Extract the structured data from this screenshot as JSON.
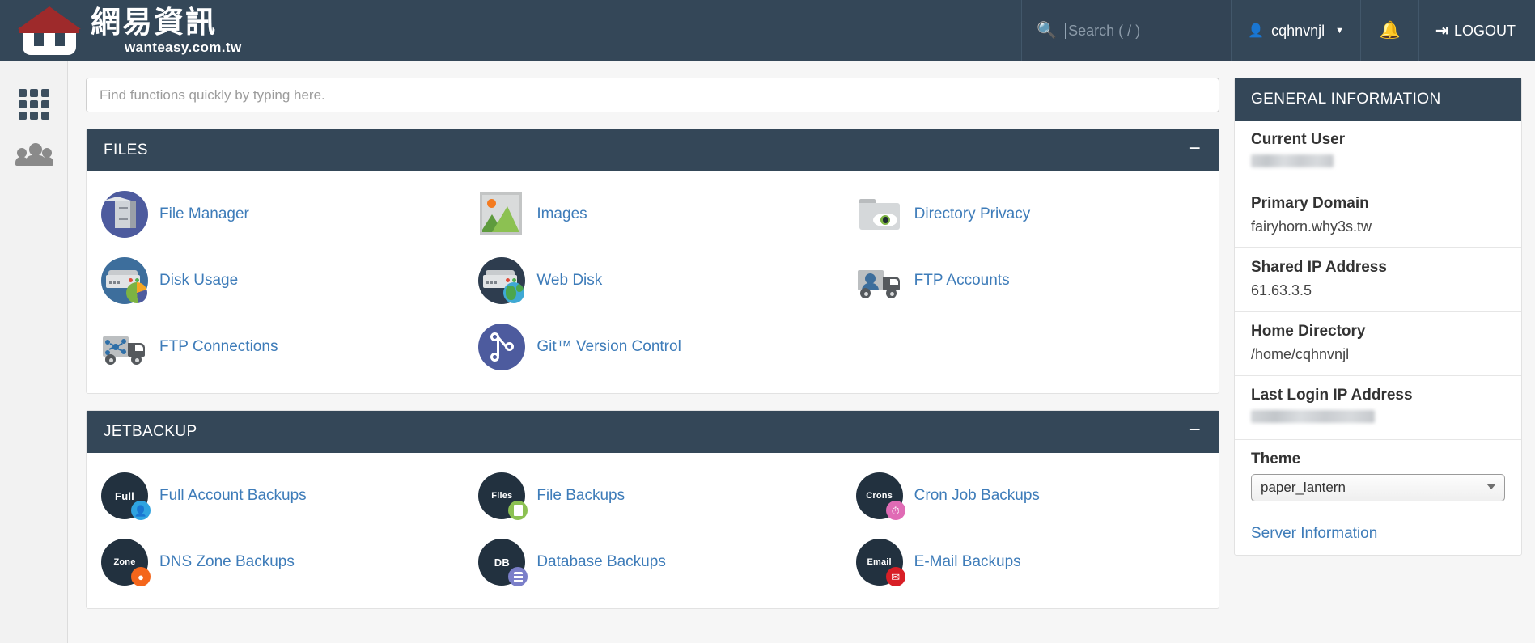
{
  "header": {
    "brand_cn": "網易資訊",
    "brand_en": "wanteasy.com.tw",
    "search_placeholder": "Search ( / )",
    "search_value": "",
    "user_name": "cqhnvnjl",
    "logout_label": "LOGOUT",
    "icons": {
      "search": "search-icon",
      "user": "user-icon",
      "chevron": "chevron-down-icon",
      "bell": "bell-icon",
      "logout": "logout-icon"
    },
    "bg_color": "#344758"
  },
  "sidebar": {
    "items": [
      {
        "name": "sidebar-item-tools",
        "icon": "grid-icon",
        "active": true
      },
      {
        "name": "sidebar-item-user-manager",
        "icon": "users-icon",
        "active": false
      }
    ]
  },
  "main": {
    "find_placeholder": "Find functions quickly by typing here.",
    "find_value": "",
    "sections": [
      {
        "title": "FILES",
        "collapse_label": "−",
        "items": [
          {
            "label": "File Manager",
            "icon": "file-manager-icon"
          },
          {
            "label": "Images",
            "icon": "images-icon"
          },
          {
            "label": "Directory Privacy",
            "icon": "directory-privacy-icon"
          },
          {
            "label": "Disk Usage",
            "icon": "disk-usage-icon"
          },
          {
            "label": "Web Disk",
            "icon": "web-disk-icon"
          },
          {
            "label": "FTP Accounts",
            "icon": "ftp-accounts-icon"
          },
          {
            "label": "FTP Connections",
            "icon": "ftp-connections-icon"
          },
          {
            "label": "Git™ Version Control",
            "icon": "git-version-control-icon"
          }
        ]
      },
      {
        "title": "JETBACKUP",
        "collapse_label": "−",
        "items": [
          {
            "label": "Full Account Backups",
            "icon": "jetbackup-full-icon",
            "badge_text": "Full",
            "badge_color": "#2fa3e0"
          },
          {
            "label": "File Backups",
            "icon": "jetbackup-files-icon",
            "badge_text": "Files",
            "badge_color": "#8cc152"
          },
          {
            "label": "Cron Job Backups",
            "icon": "jetbackup-crons-icon",
            "badge_text": "Crons",
            "badge_color": "#e06bb5"
          },
          {
            "label": "DNS Zone Backups",
            "icon": "jetbackup-zone-icon",
            "badge_text": "Zone",
            "badge_color": "#f4661b"
          },
          {
            "label": "Database Backups",
            "icon": "jetbackup-db-icon",
            "badge_text": "DB",
            "badge_color": "#7b7fc9"
          },
          {
            "label": "E-Mail Backups",
            "icon": "jetbackup-email-icon",
            "badge_text": "Email",
            "badge_color": "#d81f26"
          }
        ]
      }
    ]
  },
  "general_information": {
    "title": "GENERAL INFORMATION",
    "rows": [
      {
        "label": "Current User",
        "value": "████████",
        "redacted": true
      },
      {
        "label": "Primary Domain",
        "value": "fairyhorn.why3s.tw",
        "redacted": false
      },
      {
        "label": "Shared IP Address",
        "value": "61.63.3.5",
        "redacted": false
      },
      {
        "label": "Home Directory",
        "value": "/home/cqhnvnjl",
        "redacted": false
      },
      {
        "label": "Last Login IP Address",
        "value": "████████████",
        "redacted": true
      }
    ],
    "theme_label": "Theme",
    "theme_value": "paper_lantern",
    "server_information_label": "Server Information"
  },
  "colors": {
    "dark": "#344758",
    "link": "#3e7cb9",
    "jetbackup_circle": "#22313f"
  }
}
